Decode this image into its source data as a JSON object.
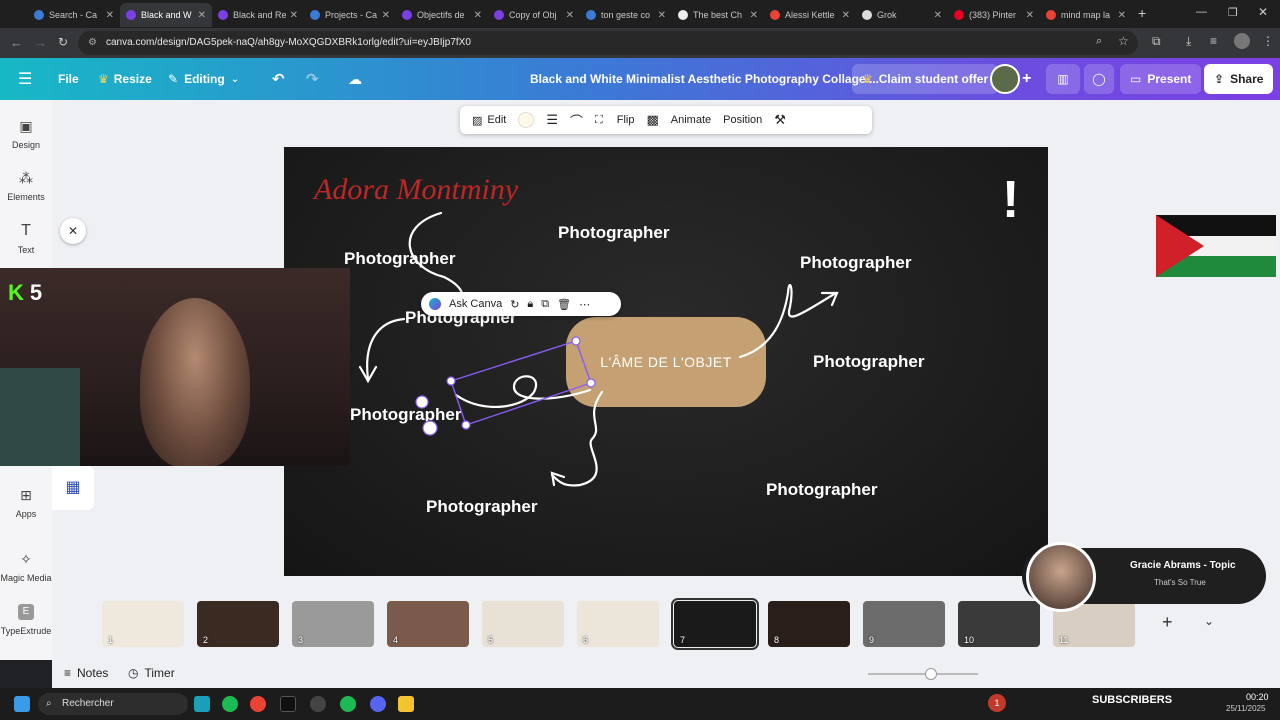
{
  "browser": {
    "tabs": [
      {
        "label": "Search - Ca",
        "color": "#3a7bd5"
      },
      {
        "label": "Black and W",
        "color": "#7b3fe4",
        "active": true
      },
      {
        "label": "Black and Re",
        "color": "#7b3fe4"
      },
      {
        "label": "Projects - Ca",
        "color": "#3a7bd5"
      },
      {
        "label": "Objectifs de",
        "color": "#7b3fe4"
      },
      {
        "label": "Copy of Obj",
        "color": "#7b3fe4"
      },
      {
        "label": "ton geste co",
        "color": "#3a7bd5"
      },
      {
        "label": "The best Ch",
        "color": "#eeeeee"
      },
      {
        "label": "Alessi Kettle",
        "color": "#ea4335"
      },
      {
        "label": "Grok",
        "color": "#dddddd"
      },
      {
        "label": "(383) Pinter",
        "color": "#e60023"
      },
      {
        "label": "mind map la",
        "color": "#ea4335"
      }
    ],
    "url": "canva.com/design/DAG5pek-naQ/ah8gy-MoXQGDXBRk1orlg/edit?ui=eyJBIjp7fX0"
  },
  "topbar": {
    "file": "File",
    "resize": "Resize",
    "editing": "Editing",
    "doc_title": "Black and White Minimalist Aesthetic Photography Collage ...",
    "claim": "Claim student offer",
    "present": "Present",
    "share": "Share"
  },
  "sidebar": {
    "items": [
      {
        "label": "Design"
      },
      {
        "label": "Elements"
      },
      {
        "label": "Text"
      },
      {
        "label": "Apps"
      },
      {
        "label": "Magic Media"
      },
      {
        "label": "TypeExtrude"
      }
    ]
  },
  "ctxbar": {
    "edit": "Edit",
    "flip": "Flip",
    "animate": "Animate",
    "position": "Position"
  },
  "canvas": {
    "script_title": "Adora Montminy",
    "center": "L'ÂME DE L'OBJET",
    "photographer": "Photographer"
  },
  "askbar": {
    "label": "Ask Canva"
  },
  "webcam": {
    "badge": "5"
  },
  "pages": {
    "thumbs": [
      1,
      2,
      3,
      4,
      5,
      6,
      7,
      8,
      9,
      10,
      11
    ],
    "selected": 7
  },
  "music": {
    "title": "Gracie Abrams - Topic",
    "subtitle": "That's So True"
  },
  "bottom": {
    "notes": "Notes",
    "timer": "Timer"
  },
  "taskbar": {
    "search": "Rechercher",
    "subscribers": "SUBSCRIBERS",
    "time": "00:20",
    "date": "25/11/2025",
    "notif": "1"
  }
}
